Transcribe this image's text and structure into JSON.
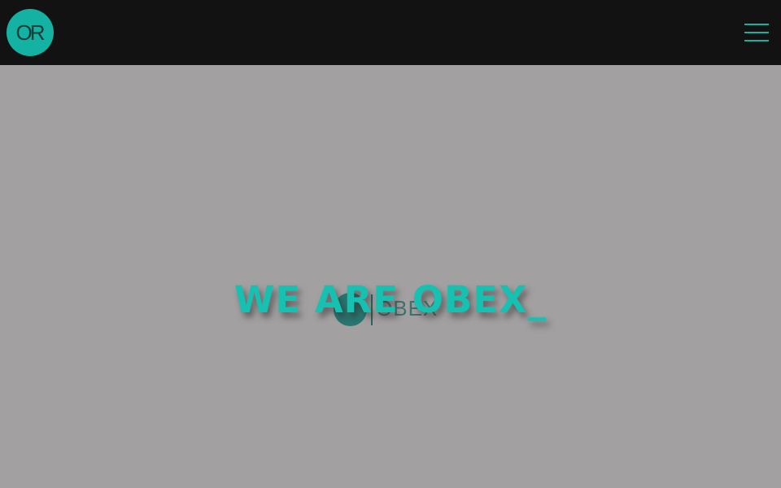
{
  "header": {
    "logo_text": "OR",
    "menu_icon": "hamburger-menu-icon"
  },
  "hero": {
    "headline": "WE ARE OBEX_",
    "background_logo_text": "OBEX"
  },
  "colors": {
    "topbar_bg": "#121212",
    "accent": "#13b2a3",
    "hero_bg": "#a3a0a1",
    "headline": "#17c1b1"
  }
}
